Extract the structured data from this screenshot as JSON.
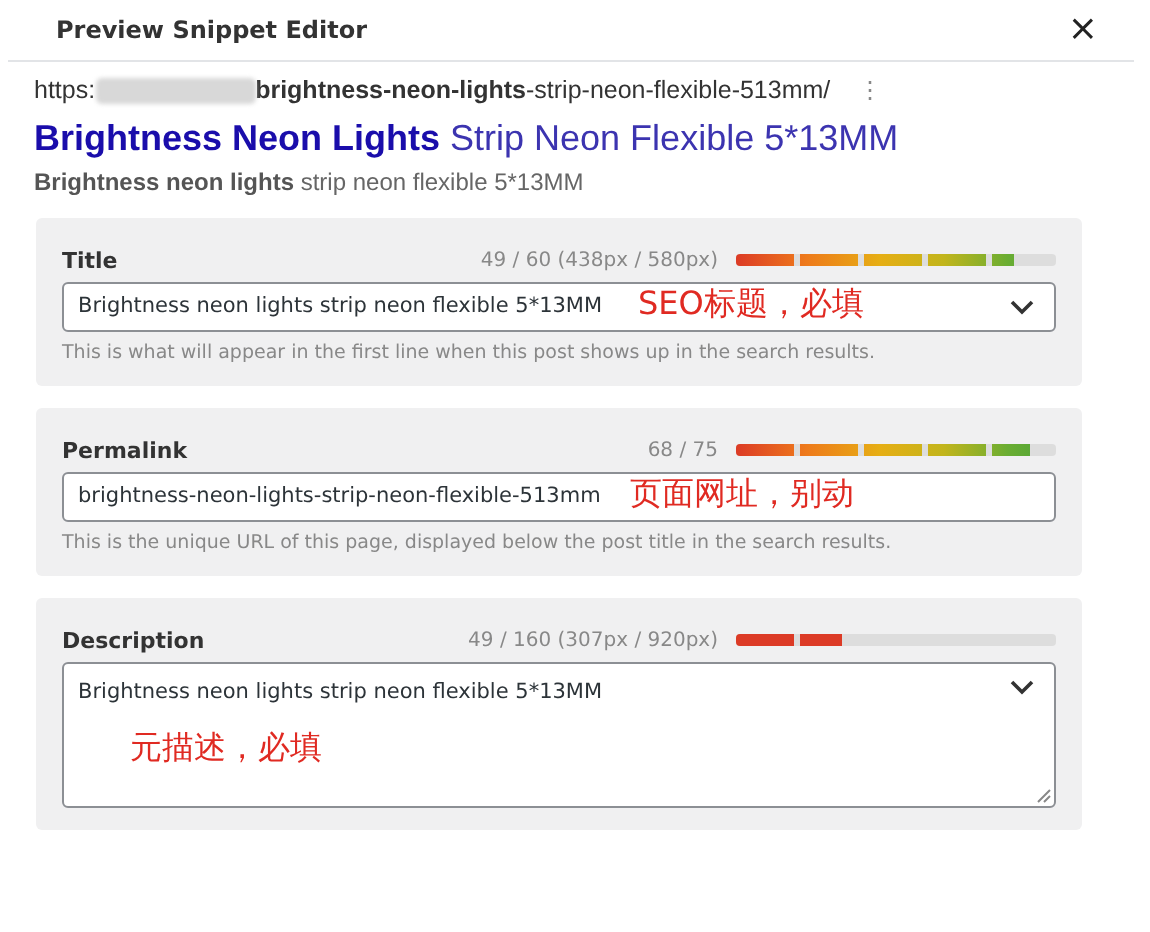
{
  "dialog": {
    "title": "Preview Snippet Editor",
    "close": "×"
  },
  "preview": {
    "url_start": "https:",
    "url_rest": "**brightness-neon-lights**-strip-neon-flexible-513mm/",
    "more": "⋮",
    "title": "**Brightness Neon Lights** Strip Neon Flexible 5*13MM",
    "description": "**Brightness neon lights** strip neon flexible 5*13MM"
  },
  "fields": [
    {
      "kind": "select",
      "label": "Title",
      "counter": "49 / 60 (438px / 580px)",
      "level": 0.87,
      "value": "Brightness neon lights strip neon flexible 5*13MM",
      "annotation": "SEO标题，必填",
      "help": "This is what will appear in the first line when this post shows up in the search results."
    },
    {
      "kind": "text",
      "label": "Permalink",
      "counter": "68 / 75",
      "level": 0.92,
      "value": "brightness-neon-lights-strip-neon-flexible-513mm",
      "annotation": "页面网址，别动",
      "help": "This is the unique URL of this page, displayed below the post title in the search results."
    },
    {
      "kind": "textarea",
      "label": "Description",
      "counter": "49 / 160 (307px / 920px)",
      "level": 0.33,
      "value": "Brightness neon lights strip neon flexible 5*13MM",
      "annotation": "元描述，必填"
    }
  ]
}
